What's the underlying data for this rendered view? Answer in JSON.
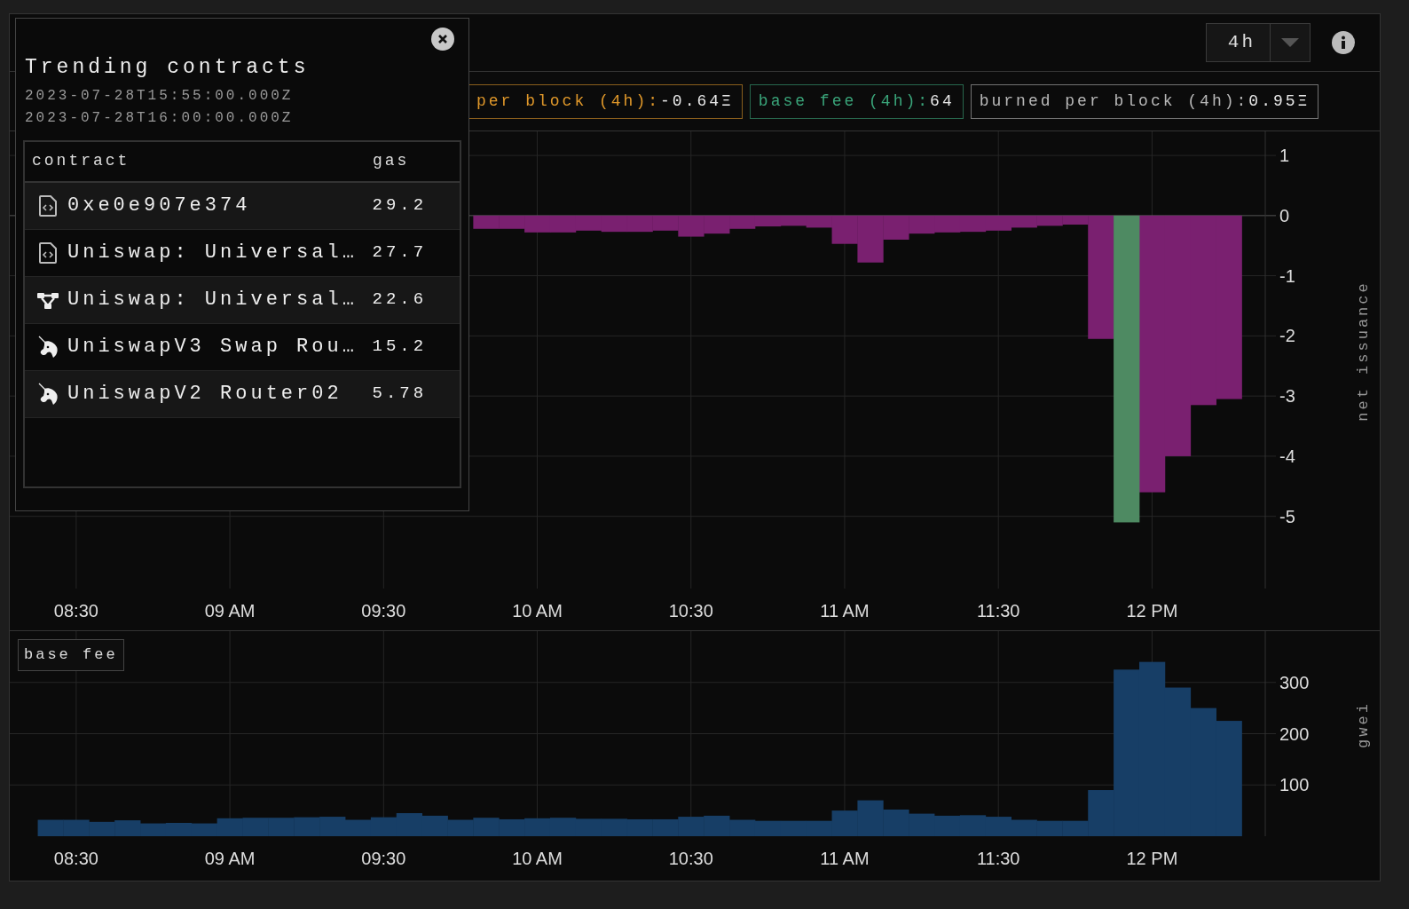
{
  "toolbar": {
    "range_select": {
      "value": "4h"
    }
  },
  "summary_chips": [
    {
      "label": "per block (4h):",
      "value": "-0.64Ξ",
      "color": "#e0982a"
    },
    {
      "label": "base fee (4h):",
      "value": "64",
      "color": "#3aa57a"
    },
    {
      "label": "burned per block (4h):",
      "value": "0.95Ξ",
      "color": "#b8b8b8"
    }
  ],
  "issuance_chart": {
    "chart_data": {
      "type": "bar",
      "grid": true,
      "ylabel": "net issuance",
      "categories": [
        null,
        "08:30",
        null,
        null,
        null,
        null,
        null,
        "09 AM",
        null,
        null,
        null,
        null,
        null,
        "09:30",
        null,
        null,
        null,
        null,
        null,
        "10 AM",
        null,
        null,
        null,
        null,
        null,
        "10:30",
        null,
        null,
        null,
        null,
        null,
        "11 AM",
        null,
        null,
        null,
        null,
        null,
        "11:30",
        null,
        null,
        null,
        null,
        null,
        "12 PM",
        null,
        null,
        null
      ],
      "series": [
        {
          "color": "#7a2070",
          "values": [
            null,
            null,
            null,
            null,
            null,
            null,
            null,
            null,
            null,
            null,
            null,
            null,
            null,
            null,
            null,
            null,
            null,
            -0.22,
            -0.22,
            -0.28,
            -0.28,
            -0.25,
            -0.27,
            -0.27,
            -0.25,
            -0.35,
            -0.3,
            -0.22,
            -0.18,
            -0.17,
            -0.2,
            -0.47,
            -0.78,
            -0.4,
            -0.3,
            -0.28,
            -0.27,
            -0.25,
            -0.2,
            -0.17,
            -0.15,
            -2.05,
            null,
            -4.6,
            -4.0,
            -3.15,
            -3.05
          ]
        },
        {
          "color": "#4e8a62",
          "values": [
            null,
            null,
            null,
            null,
            null,
            null,
            null,
            null,
            null,
            null,
            null,
            null,
            null,
            null,
            null,
            null,
            null,
            null,
            null,
            null,
            null,
            null,
            null,
            null,
            null,
            null,
            null,
            null,
            null,
            null,
            null,
            null,
            null,
            null,
            null,
            null,
            null,
            null,
            null,
            null,
            null,
            null,
            -5.1,
            null,
            null,
            null,
            null
          ]
        }
      ],
      "ylim": [
        -6.2,
        1.4
      ],
      "yticks": [
        1,
        0,
        -1,
        -2,
        -3,
        -4,
        -5
      ]
    }
  },
  "base_fee_chart": {
    "legend": "base fee",
    "chart_data": {
      "type": "bar",
      "grid": true,
      "ylabel": "gwei",
      "categories": [
        null,
        "08:30",
        null,
        null,
        null,
        null,
        null,
        "09 AM",
        null,
        null,
        null,
        null,
        null,
        "09:30",
        null,
        null,
        null,
        null,
        null,
        "10 AM",
        null,
        null,
        null,
        null,
        null,
        "10:30",
        null,
        null,
        null,
        null,
        null,
        "11 AM",
        null,
        null,
        null,
        null,
        null,
        "11:30",
        null,
        null,
        null,
        null,
        null,
        "12 PM",
        null,
        null,
        null
      ],
      "series": [
        {
          "color": "#173e66",
          "values": [
            32,
            32,
            28,
            31,
            25,
            26,
            25,
            35,
            36,
            36,
            37,
            38,
            32,
            37,
            45,
            40,
            32,
            36,
            33,
            35,
            36,
            34,
            34,
            33,
            33,
            38,
            40,
            32,
            30,
            30,
            30,
            50,
            70,
            52,
            44,
            40,
            41,
            38,
            32,
            30,
            30,
            90,
            325,
            340,
            290,
            250,
            225
          ]
        }
      ],
      "ylim": [
        0,
        400
      ],
      "yticks": [
        100,
        200,
        300
      ]
    }
  },
  "trending_popup": {
    "title": "Trending contracts",
    "timestamps": [
      "2023-07-28T15:55:00.000Z",
      "2023-07-28T16:00:00.000Z"
    ],
    "columns": [
      "contract",
      "gas"
    ],
    "rows": [
      {
        "kind": "file",
        "contract": "0xe0e907e374",
        "gas": "29.2"
      },
      {
        "kind": "file",
        "contract": "Uniswap: Universal…",
        "gas": "27.7"
      },
      {
        "kind": "nodes",
        "contract": "Uniswap: Universal…",
        "gas": "22.6"
      },
      {
        "kind": "unicorn",
        "contract": "UniswapV3 Swap Rou…",
        "gas": "15.2"
      },
      {
        "kind": "unicorn",
        "contract": "UniswapV2 Router02",
        "gas": "5.78"
      }
    ]
  }
}
